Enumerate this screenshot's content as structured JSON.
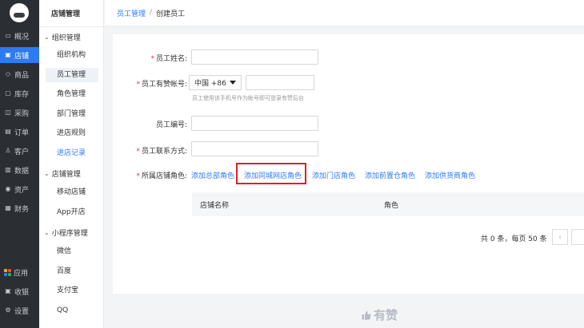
{
  "main_nav": {
    "items": [
      {
        "label": "概况",
        "icon": "monitor-icon",
        "glyph": "▭"
      },
      {
        "label": "店铺",
        "icon": "store-icon",
        "glyph": "▣",
        "active": true
      },
      {
        "label": "商品",
        "icon": "tag-icon",
        "glyph": "◇"
      },
      {
        "label": "库存",
        "icon": "inventory-icon",
        "glyph": "▢"
      },
      {
        "label": "采购",
        "icon": "purchase-icon",
        "glyph": "◫"
      },
      {
        "label": "订单",
        "icon": "order-icon",
        "glyph": "▤"
      },
      {
        "label": "客户",
        "icon": "customer-icon",
        "glyph": "♙"
      },
      {
        "label": "数据",
        "icon": "chart-icon",
        "glyph": "▥"
      },
      {
        "label": "资产",
        "icon": "asset-icon",
        "glyph": "◉"
      },
      {
        "label": "财务",
        "icon": "finance-icon",
        "glyph": "▦"
      }
    ],
    "bottom_items": [
      {
        "label": "应用",
        "icon": "apps-icon"
      },
      {
        "label": "收银",
        "icon": "cashier-icon",
        "glyph": "▣"
      },
      {
        "label": "设置",
        "icon": "settings-icon",
        "glyph": "⚙"
      }
    ],
    "active_color": "#2d7bf4",
    "app_icon_colors": [
      "#f5a623",
      "#e74c3c",
      "#2d7bf4",
      "#27ae60"
    ]
  },
  "sub_nav": {
    "title": "店铺管理",
    "groups": [
      {
        "label": "组织管理",
        "items": [
          {
            "label": "组织机构"
          },
          {
            "label": "员工管理",
            "selected": true
          },
          {
            "label": "角色管理"
          },
          {
            "label": "部门管理"
          },
          {
            "label": "进店规则"
          },
          {
            "label": "进店记录",
            "link": true
          }
        ]
      },
      {
        "label": "店铺管理",
        "items": [
          {
            "label": "移动店铺"
          },
          {
            "label": "App开店"
          }
        ]
      },
      {
        "label": "小程序管理",
        "items": [
          {
            "label": "微信"
          },
          {
            "label": "百度"
          },
          {
            "label": "支付宝"
          },
          {
            "label": "QQ"
          }
        ]
      }
    ]
  },
  "breadcrumb": {
    "parent": "员工管理",
    "separator": "/",
    "current": "创建员工"
  },
  "form": {
    "name_label": "员工姓名:",
    "name_value": "",
    "account_label": "员工有赞帐号:",
    "country_code": "中国 +86",
    "phone_value": "",
    "account_help": "员工使用该手机号作为帐号即可登录有赞后台",
    "number_label": "员工编号:",
    "number_value": "",
    "contact_label": "员工联系方式:",
    "contact_value": "",
    "roles_label": "所属店铺角色:",
    "role_links": [
      "添加总部角色",
      "添加同城网店角色",
      "添加门店角色",
      "添加前置仓角色",
      "添加供货商角色"
    ],
    "required_mark": "*"
  },
  "table": {
    "columns": [
      "店铺名称",
      "角色"
    ],
    "rows": []
  },
  "pagination": {
    "summary": "共 0 条，每页 50 条",
    "prev": "‹"
  },
  "footer": {
    "brand": "有赞"
  },
  "colors": {
    "link": "#2d7bf4",
    "required": "#e4393c",
    "highlight": "#e02020",
    "nav_bg": "#2b2e33"
  }
}
